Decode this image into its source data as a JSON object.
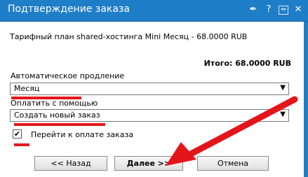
{
  "window": {
    "title": "Подтверждение заказа",
    "title_icons": [
      "pin-icon",
      "help-icon",
      "restore-icon",
      "close-icon"
    ],
    "title_glyphs": {
      "pin": "✒",
      "help": "?",
      "restore": "⇔",
      "close": "✕"
    }
  },
  "order": {
    "plan_text": "Тарифный план shared-хостинга Mini Месяц - 68.0000 RUB",
    "total_text": "Итого: 68.0000 RUB"
  },
  "auto_renew": {
    "label": "Автоматическое продление",
    "value": "Месяц"
  },
  "payment": {
    "label": "Оплатить с помощью",
    "value": "Создать новый заказ"
  },
  "goto_payment": {
    "label": "Перейти к оплате заказа",
    "checked": true
  },
  "buttons": {
    "back": "<< Назад",
    "next": "Далее >>",
    "cancel": "Отмена"
  },
  "colors": {
    "titlebar": "#1e7ec7",
    "annotation": "#e3151a"
  }
}
